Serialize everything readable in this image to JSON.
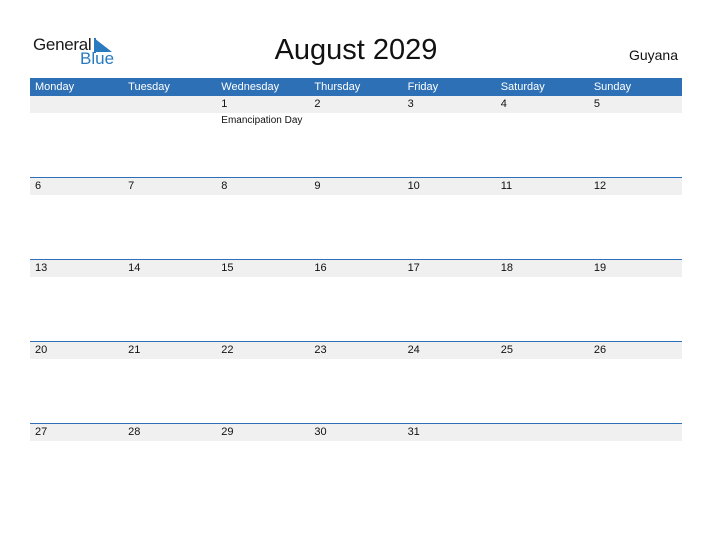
{
  "logo": {
    "part1": "General",
    "part2": "Blue"
  },
  "title": "August 2029",
  "country": "Guyana",
  "colors": {
    "accent": "#2e70b5",
    "strip": "#f0f0f0",
    "logo_blue": "#2a7ac0"
  },
  "weekdays": [
    "Monday",
    "Tuesday",
    "Wednesday",
    "Thursday",
    "Friday",
    "Saturday",
    "Sunday"
  ],
  "weeks": [
    {
      "days": [
        "",
        "",
        "1",
        "2",
        "3",
        "4",
        "5"
      ],
      "events": [
        "",
        "",
        "Emancipation Day",
        "",
        "",
        "",
        ""
      ]
    },
    {
      "days": [
        "6",
        "7",
        "8",
        "9",
        "10",
        "11",
        "12"
      ],
      "events": [
        "",
        "",
        "",
        "",
        "",
        "",
        ""
      ]
    },
    {
      "days": [
        "13",
        "14",
        "15",
        "16",
        "17",
        "18",
        "19"
      ],
      "events": [
        "",
        "",
        "",
        "",
        "",
        "",
        ""
      ]
    },
    {
      "days": [
        "20",
        "21",
        "22",
        "23",
        "24",
        "25",
        "26"
      ],
      "events": [
        "",
        "",
        "",
        "",
        "",
        "",
        ""
      ]
    },
    {
      "days": [
        "27",
        "28",
        "29",
        "30",
        "31",
        "",
        ""
      ],
      "events": [
        "",
        "",
        "",
        "",
        "",
        "",
        ""
      ]
    }
  ]
}
